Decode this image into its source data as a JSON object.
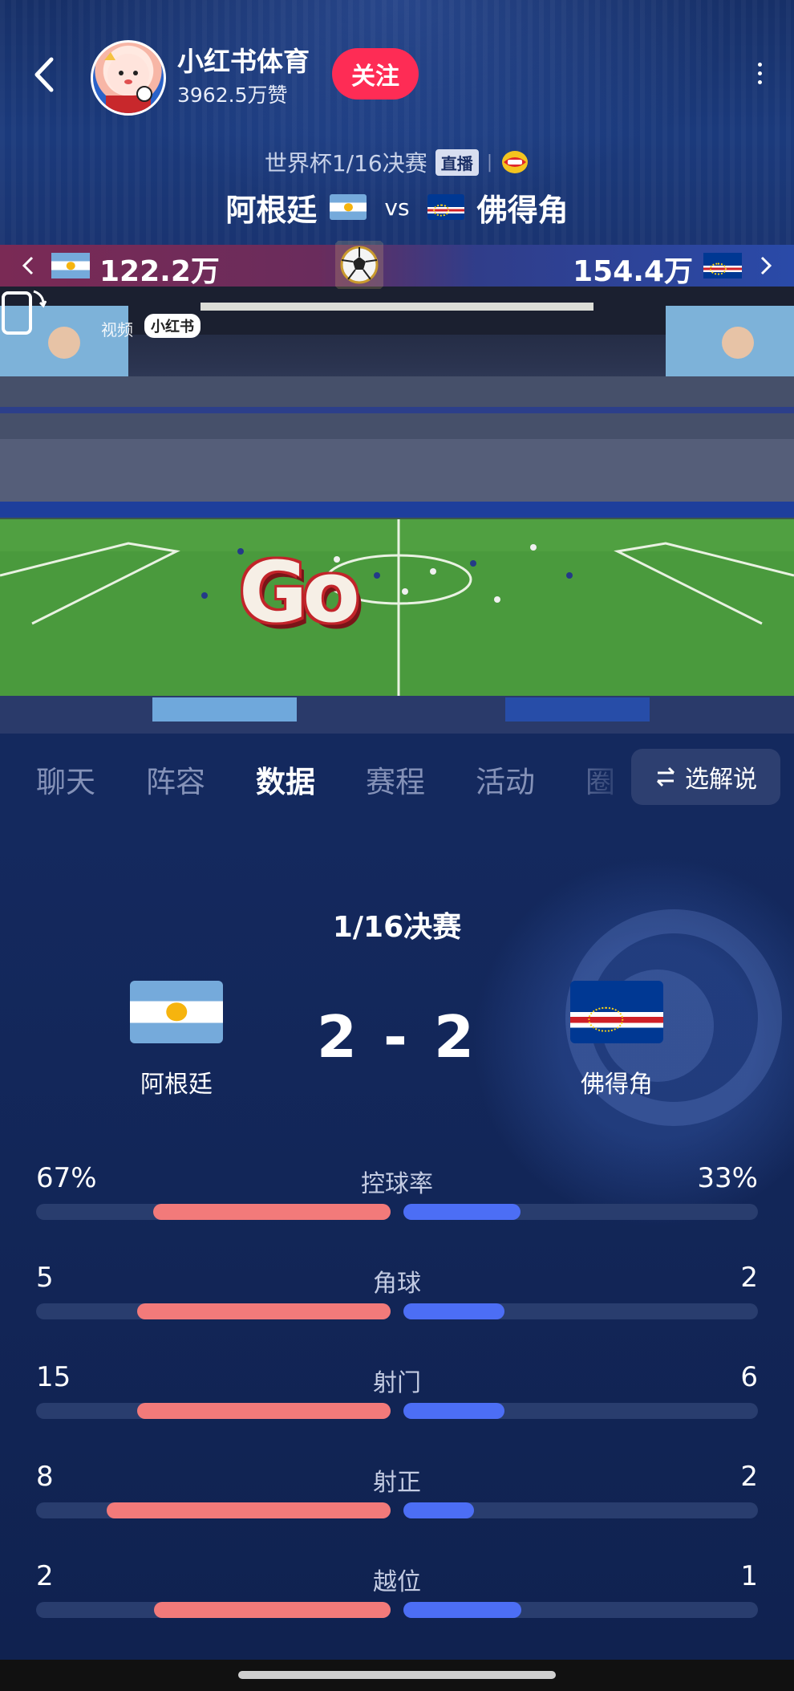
{
  "header": {
    "account_name": "小红书体育",
    "likes": "3962.5万赞",
    "follow_label": "关注"
  },
  "match": {
    "round_title": "世界杯1/16决赛",
    "live_tag": "直播",
    "home_team": "阿根廷",
    "vs": "vs",
    "away_team": "佛得角"
  },
  "support": {
    "home_count": "122.2万",
    "away_count": "154.4万"
  },
  "video": {
    "watermark_label": "视频",
    "watermark_brand": "小红书",
    "overlay_text": "Go"
  },
  "tabs": [
    {
      "label": "聊天",
      "active": false
    },
    {
      "label": "阵容",
      "active": false
    },
    {
      "label": "数据",
      "active": true
    },
    {
      "label": "赛程",
      "active": false
    },
    {
      "label": "活动",
      "active": false
    },
    {
      "label": "圈",
      "active": false
    }
  ],
  "commentary_button": "选解说",
  "scoreboard": {
    "round": "1/16决赛",
    "home_team": "阿根廷",
    "away_team": "佛得角",
    "score": "2 - 2"
  },
  "stats": [
    {
      "label": "控球率",
      "home": "67%",
      "away": "33%",
      "home_fill": 0.67,
      "away_fill": 0.33
    },
    {
      "label": "角球",
      "home": "5",
      "away": "2",
      "home_fill": 0.714,
      "away_fill": 0.286
    },
    {
      "label": "射门",
      "home": "15",
      "away": "6",
      "home_fill": 0.714,
      "away_fill": 0.286
    },
    {
      "label": "射正",
      "home": "8",
      "away": "2",
      "home_fill": 0.8,
      "away_fill": 0.2
    },
    {
      "label": "越位",
      "home": "2",
      "away": "1",
      "home_fill": 0.667,
      "away_fill": 0.333
    }
  ],
  "colors": {
    "home_bar": "#f27a7a",
    "away_bar": "#4c6ef5",
    "follow": "#fe2c55",
    "background": "#0f2150"
  },
  "icons": [
    "back-arrow-icon",
    "more-icon",
    "sponsor-logo-icon",
    "football-icon",
    "rotate-screen-icon",
    "swap-icon",
    "chevron-left-icon",
    "chevron-right-icon"
  ]
}
